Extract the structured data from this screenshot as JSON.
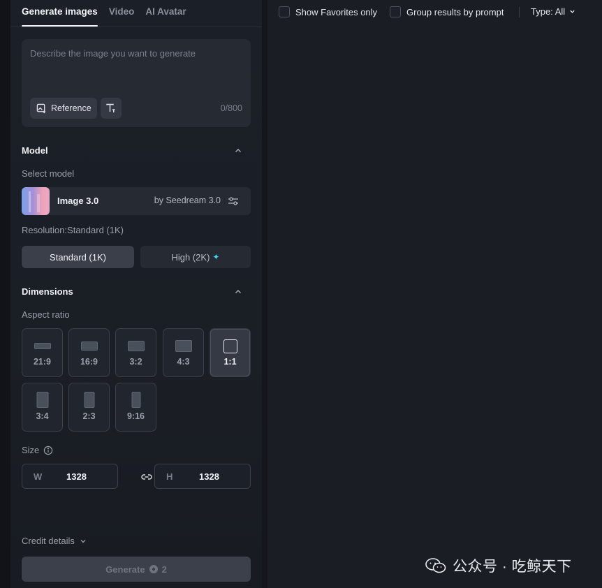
{
  "tabs": [
    {
      "label": "Generate images",
      "active": true
    },
    {
      "label": "Video",
      "active": false
    },
    {
      "label": "AI Avatar",
      "active": false
    }
  ],
  "prompt": {
    "placeholder": "Describe the image you want to generate",
    "reference_label": "Reference",
    "char_count": "0/800"
  },
  "model_section": {
    "title": "Model",
    "select_label": "Select model",
    "model_name": "Image 3.0",
    "model_by": "by Seedream 3.0",
    "resolution_label": "Resolution:Standard (1K)",
    "resolution_options": [
      {
        "label": "Standard (1K)",
        "selected": true
      },
      {
        "label": "High (2K)",
        "selected": false
      }
    ]
  },
  "dimensions_section": {
    "title": "Dimensions",
    "aspect_label": "Aspect ratio",
    "aspect_ratios": [
      {
        "label": "21:9",
        "selected": false
      },
      {
        "label": "16:9",
        "selected": false
      },
      {
        "label": "3:2",
        "selected": false
      },
      {
        "label": "4:3",
        "selected": false
      },
      {
        "label": "1:1",
        "selected": true
      },
      {
        "label": "3:4",
        "selected": false
      },
      {
        "label": "2:3",
        "selected": false
      },
      {
        "label": "9:16",
        "selected": false
      }
    ],
    "size_label": "Size",
    "width_prefix": "W",
    "width_value": "1328",
    "height_prefix": "H",
    "height_value": "1328"
  },
  "footer": {
    "credit_label": "Credit details",
    "generate_label": "Generate",
    "generate_cost": "2"
  },
  "results_toolbar": {
    "favorites_label": "Show Favorites only",
    "group_label": "Group results by prompt",
    "type_label": "Type: All"
  },
  "watermark": {
    "text": "公众号 · 吃鲸天下"
  },
  "colors": {
    "panel_bg": "#1b1f27",
    "results_bg": "#1a1d24",
    "accent_spark": "#3fd9f0"
  }
}
